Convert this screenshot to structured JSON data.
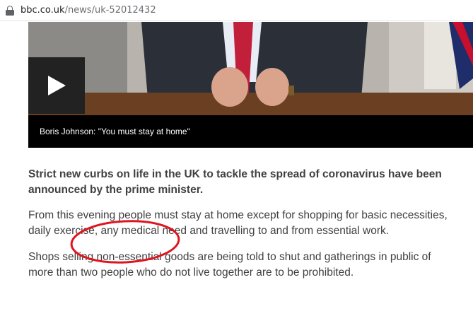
{
  "browser": {
    "url_host": "bbc.co.uk",
    "url_path": "/news/uk-52012432"
  },
  "video": {
    "caption": "Boris Johnson: \"You must stay at home\"",
    "play_icon": "play-icon"
  },
  "article": {
    "lead": "Strict new curbs on life in the UK to tackle the spread of coronavirus have been announced by the prime minister.",
    "paragraphs": [
      "From this evening people must stay at home except for shopping for basic necessities, daily exercise, any medical need and travelling to and from essential work.",
      "Shops selling non-essential goods are being told to shut and gatherings in public of more than two people who do not live together are to be prohibited."
    ]
  },
  "annotation": {
    "color": "#e0141e"
  }
}
